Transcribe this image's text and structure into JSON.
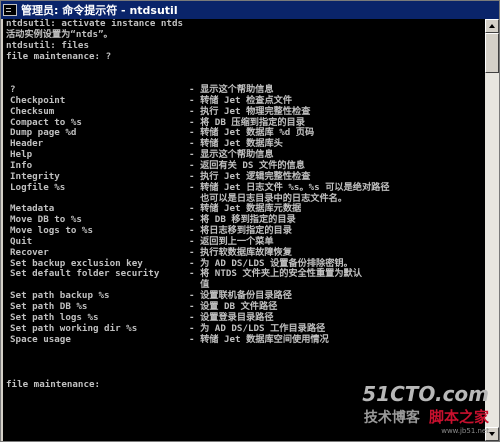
{
  "window": {
    "title": "管理员: 命令提示符 - ntdsutil"
  },
  "console": {
    "lines": [
      "ntdsutil: activate instance ntds",
      "活动实例设置为“ntds”。",
      "ntdsutil: files",
      "file maintenance: ?"
    ],
    "commands": [
      {
        "name": "?",
        "desc": "- 显示这个帮助信息"
      },
      {
        "name": "Checkpoint",
        "desc": "- 转储 Jet 检查点文件"
      },
      {
        "name": "Checksum",
        "desc": "- 执行 Jet 物理完整性检查"
      },
      {
        "name": "Compact to %s",
        "desc": "- 将 DB 压缩到指定的目录"
      },
      {
        "name": "Dump page %d",
        "desc": "- 转储 Jet 数据库 %d 页码"
      },
      {
        "name": "Header",
        "desc": "- 转储 Jet 数据库头"
      },
      {
        "name": "Help",
        "desc": "- 显示这个帮助信息"
      },
      {
        "name": "Info",
        "desc": "- 返回有关 DS 文件的信息"
      },
      {
        "name": "Integrity",
        "desc": "- 执行 Jet 逻辑完整性检查"
      },
      {
        "name": "Logfile %s",
        "desc": "- 转储 Jet 日志文件 %s。%s 可以是绝对路径"
      },
      {
        "name": "",
        "desc": "  也可以是日志目录中的日志文件名。"
      },
      {
        "name": "Metadata",
        "desc": "- 转储 Jet 数据库元数据"
      },
      {
        "name": "Move DB to %s",
        "desc": "- 将 DB 移到指定的目录"
      },
      {
        "name": "Move logs to %s",
        "desc": "- 将日志移到指定的目录"
      },
      {
        "name": "Quit",
        "desc": "- 返回到上一个菜单"
      },
      {
        "name": "Recover",
        "desc": "- 执行软数据库故障恢复"
      },
      {
        "name": "Set backup exclusion key",
        "desc": "- 为 AD DS/LDS 设置备份排除密钥。"
      },
      {
        "name": "Set default folder security",
        "desc": "- 将 NTDS 文件夹上的安全性重置为默认"
      },
      {
        "name": "",
        "desc": "  值"
      },
      {
        "name": "Set path backup %s",
        "desc": "- 设置联机备份目录路径"
      },
      {
        "name": "Set path DB %s",
        "desc": "- 设置 DB 文件路径"
      },
      {
        "name": "Set path logs %s",
        "desc": "- 设置登录目录路径"
      },
      {
        "name": "Set path working dir %s",
        "desc": "- 为 AD DS/LDS 工作目录路径"
      },
      {
        "name": "Space usage",
        "desc": "- 转储 Jet 数据库空间使用情况"
      }
    ],
    "prompt": "file maintenance:"
  },
  "watermark": {
    "line1": "51CTO.com",
    "line2": "技术博客",
    "line3": "脚本之家",
    "line4": "www.jb51.net"
  }
}
